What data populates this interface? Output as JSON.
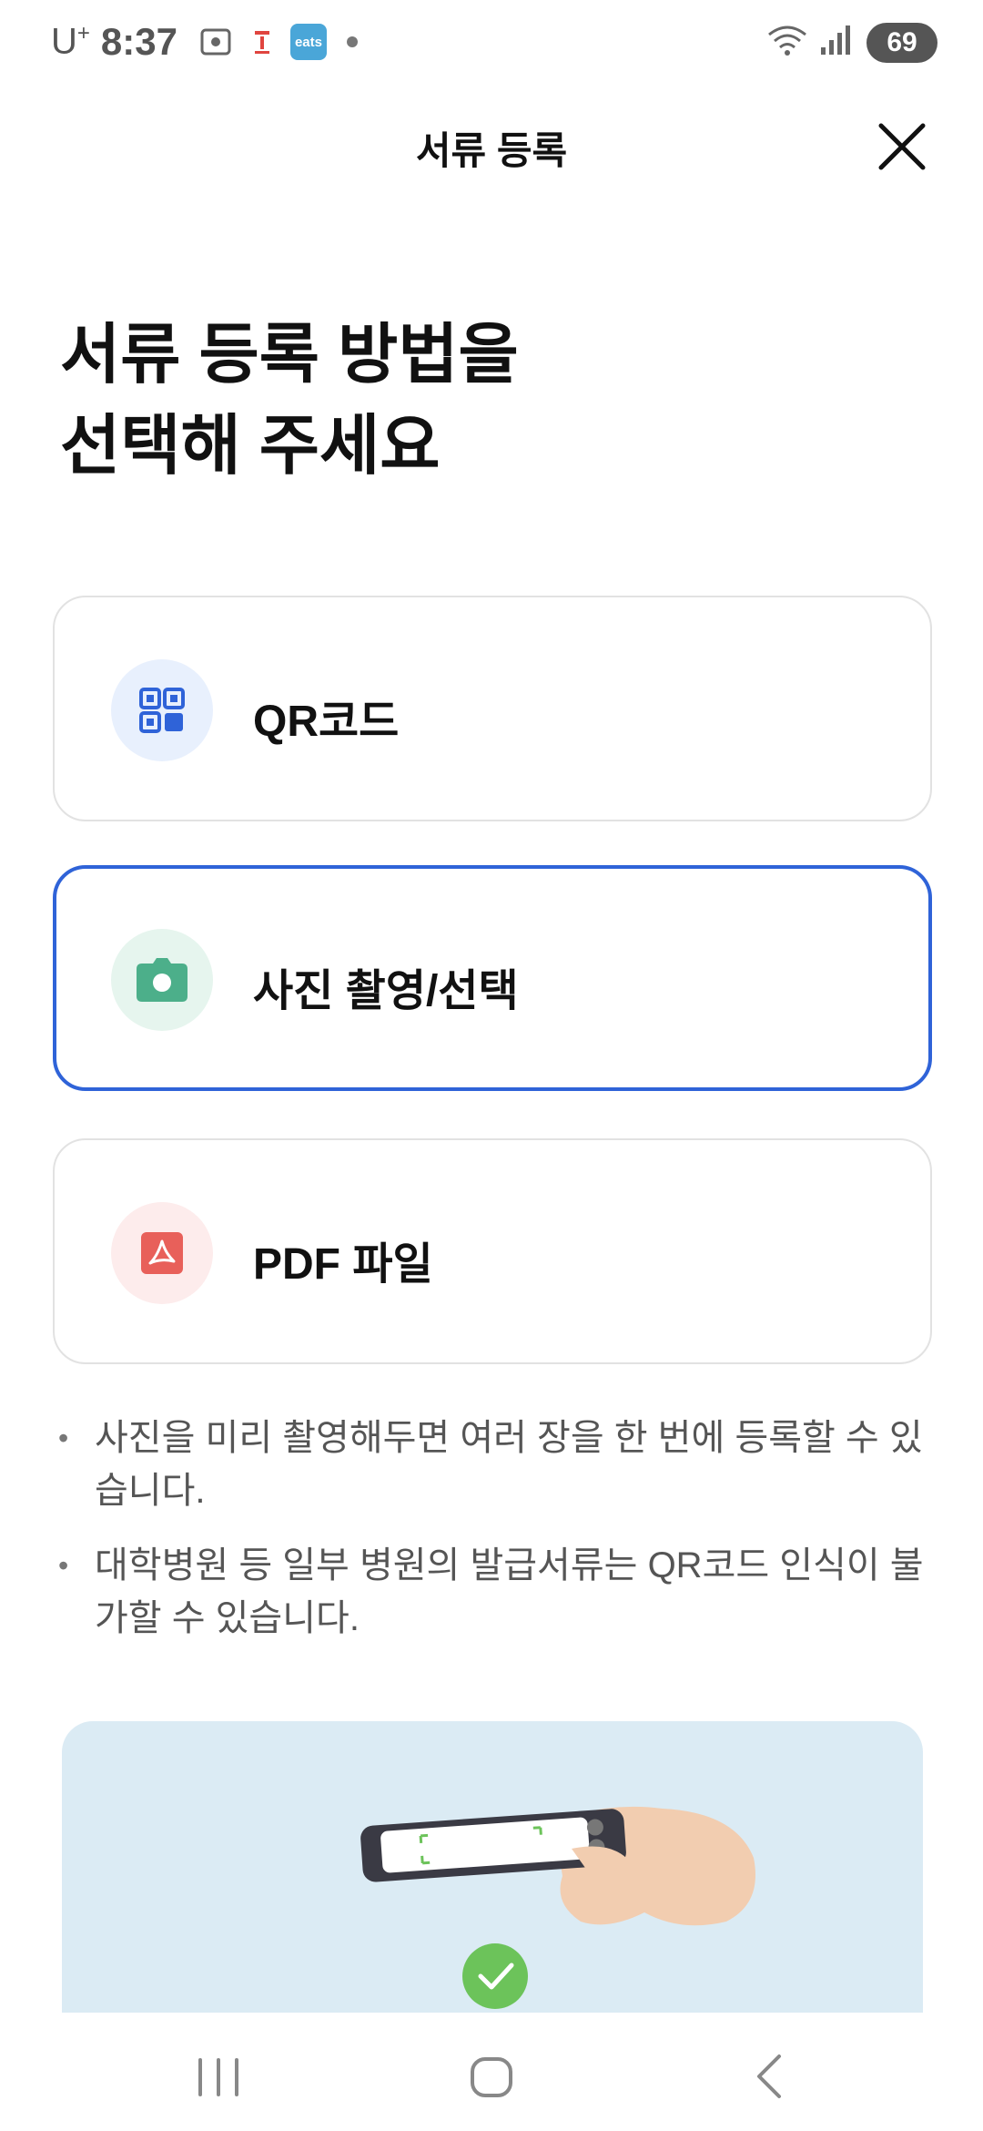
{
  "status_bar": {
    "carrier": "U",
    "carrier_sup": "+",
    "time": "8:37",
    "eats_label": "eats",
    "battery": "69"
  },
  "header": {
    "title": "서류 등록"
  },
  "heading": {
    "line1": "서류 등록 방법을",
    "line2": "선택해 주세요"
  },
  "options": [
    {
      "label": "QR코드",
      "icon": "qr-code-icon",
      "color": "#2f63d8",
      "bg": "#e8f0fd",
      "selected": false
    },
    {
      "label": "사진 촬영/선택",
      "icon": "camera-icon",
      "color": "#4caf8a",
      "bg": "#e6f5ee",
      "selected": true
    },
    {
      "label": "PDF 파일",
      "icon": "pdf-icon",
      "color": "#e8605a",
      "bg": "#fdecec",
      "selected": false
    }
  ],
  "notes": [
    "사진을 미리 촬영해두면 여러 장을 한 번에 등록할 수 있습니다.",
    "대학병원 등 일부 병원의 발급서류는 QR코드 인식이 불가할 수 있습니다."
  ],
  "colors": {
    "accent": "#2f63d8",
    "illustration_bg": "#dbebf4",
    "check_green": "#6cc35a"
  }
}
